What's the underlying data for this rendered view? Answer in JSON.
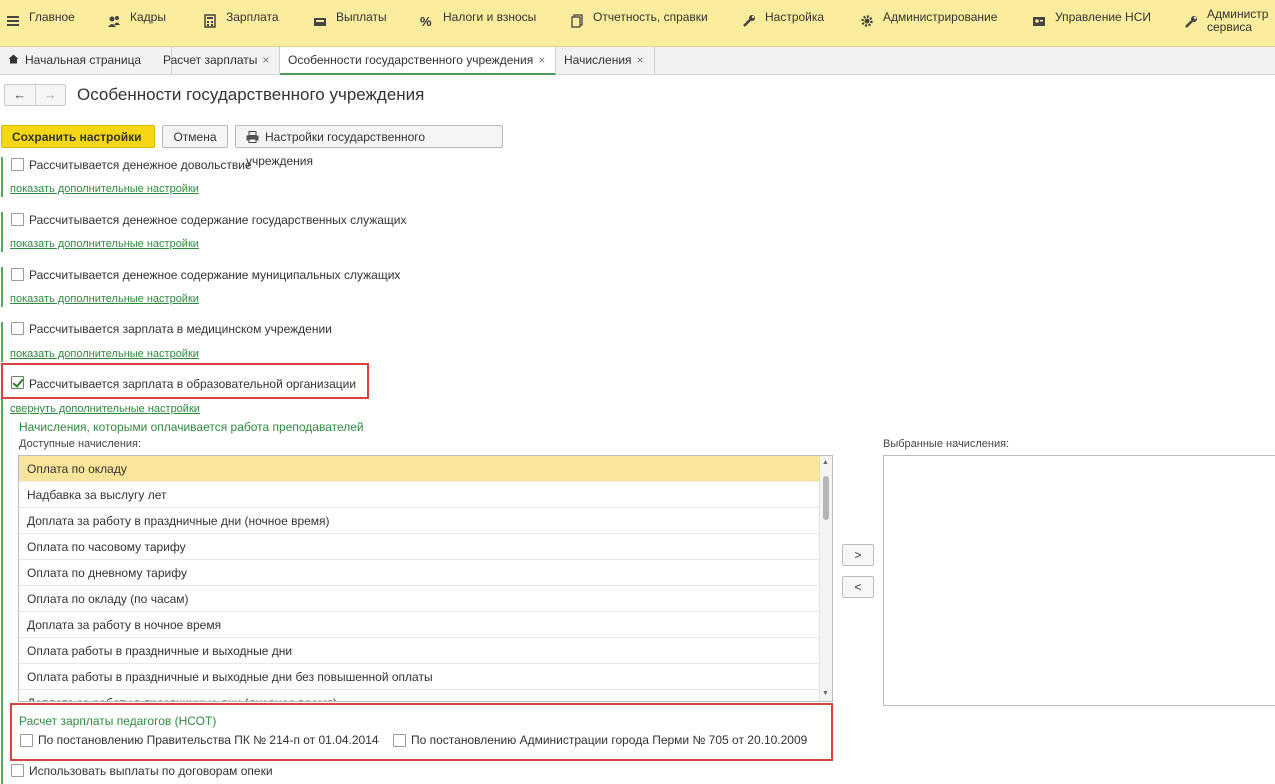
{
  "menu": [
    {
      "label": "Главное",
      "icon": "hamburger-icon"
    },
    {
      "label": "Кадры",
      "icon": "people-icon"
    },
    {
      "label": "Зарплата",
      "icon": "calculator-icon"
    },
    {
      "label": "Выплаты",
      "icon": "wallet-icon"
    },
    {
      "label": "Налоги и взносы",
      "icon": "percent-icon"
    },
    {
      "label": "Отчетность, справки",
      "icon": "documents-icon"
    },
    {
      "label": "Настройка",
      "icon": "wrench-icon"
    },
    {
      "label": "Администрирование",
      "icon": "gear-icon"
    },
    {
      "label": "Управление НСИ",
      "icon": "card-icon"
    },
    {
      "label_line1": "Администр",
      "label_line2": "сервиса",
      "icon": "wrench-icon"
    }
  ],
  "tabs": [
    {
      "label": "Начальная страница"
    },
    {
      "label": "Расчет зарплаты"
    },
    {
      "label": "Особенности государственного учреждения"
    },
    {
      "label": "Начисления"
    }
  ],
  "tab_close": "×",
  "nav": {
    "back": "←",
    "forward": "→"
  },
  "page_title": "Особенности государственного учреждения",
  "toolbar": {
    "save": "Сохранить настройки",
    "cancel": "Отмена",
    "gov_settings": "Настройки государственного учреждения"
  },
  "options": [
    {
      "label": "Рассчитывается денежное довольствие",
      "checked": false,
      "link": "показать дополнительные настройки"
    },
    {
      "label": "Рассчитывается денежное содержание государственных служащих",
      "checked": false,
      "link": "показать дополнительные настройки"
    },
    {
      "label": "Рассчитывается денежное содержание муниципальных служащих",
      "checked": false,
      "link": "показать дополнительные настройки"
    },
    {
      "label": "Рассчитывается зарплата в медицинском учреждении",
      "checked": false,
      "link": "показать дополнительные настройки"
    },
    {
      "label": "Рассчитывается зарплата в образовательной организации",
      "checked": true,
      "link": "свернуть дополнительные настройки"
    }
  ],
  "teachers_section": "Начисления, которыми оплачивается работа преподавателей",
  "available_label": "Доступные начисления:",
  "selected_label": "Выбранные начисления:",
  "available_items": [
    "Оплата по окладу",
    "Надбавка за выслугу лет",
    "Доплата за работу в праздничные дни (ночное время)",
    "Оплата по часовому тарифу",
    "Оплата по дневному тарифу",
    "Оплата по окладу (по часам)",
    "Доплата за работу в ночное время",
    "Оплата работы в праздничные и выходные дни",
    "Оплата работы в праздничные и выходные дни без повышенной оплаты",
    "Доплата за работу в праздничные дни (дневное время)"
  ],
  "move_right": ">",
  "move_left": "<",
  "nsot": {
    "title": "Расчет зарплаты педагогов (НСОТ)",
    "opt1": "По постановлению Правительства ПК № 214-п от 01.04.2014",
    "opt2": "По постановлению Администрации города Перми № 705 от 20.10.2009"
  },
  "guardianship": "Использовать выплаты по договорам опеки",
  "colors": {
    "menubar": "#fbed9e",
    "primary": "#f5d813",
    "link": "#2e8b3e",
    "highlight": "#d9433b"
  }
}
